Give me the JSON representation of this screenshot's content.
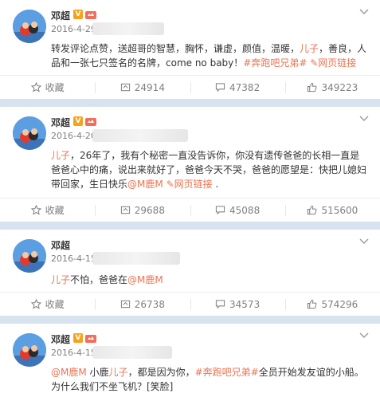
{
  "colors": {
    "accent": "#eb7350",
    "meta": "#808080",
    "separator": "#d7e3ef",
    "badge": "#f7a21a"
  },
  "posts": [
    {
      "user": "邓超",
      "timestamp": "2016-4-29",
      "content": [
        {
          "t": "转发评论点赞，送超哥的智慧，胸怀，谦虚，颜值，温暖，"
        },
        {
          "t": "儿子",
          "h": true
        },
        {
          "t": "，善良，人品和一张七只签名的名牌，come no baby！"
        },
        {
          "t": "#奔跑吧兄弟#",
          "h": true
        },
        {
          "t": " "
        },
        {
          "t": "✎网页链接",
          "h": true
        }
      ],
      "actions": {
        "favorite": "收藏",
        "repost": "24914",
        "comment": "47382",
        "like": "349223"
      }
    },
    {
      "user": "邓超",
      "timestamp": "2016-4-20",
      "content": [
        {
          "t": "儿子",
          "h": true
        },
        {
          "t": "，26年了，我有个秘密一直没告诉你，你没有遗传爸爸的长相一直是爸爸心中的痛，说出来就好了，爸爸今天不哭，爸爸的愿望是：快把儿媳妇带回家，生日快乐"
        },
        {
          "t": "@M鹿M",
          "h": true
        },
        {
          "t": " "
        },
        {
          "t": "✎网页链接",
          "h": true
        },
        {
          "t": " ."
        }
      ],
      "actions": {
        "favorite": "收藏",
        "repost": "29688",
        "comment": "45088",
        "like": "515600"
      }
    },
    {
      "user": "邓超",
      "timestamp": "2016-4-15",
      "content": [
        {
          "t": "儿子",
          "h": true
        },
        {
          "t": "不怕，爸爸在"
        },
        {
          "t": "@M鹿M",
          "h": true
        }
      ],
      "actions": {
        "favorite": "收藏",
        "repost": "26738",
        "comment": "34573",
        "like": "574296"
      }
    },
    {
      "user": "邓超",
      "timestamp": "2016-4-15",
      "content": [
        {
          "t": "@M鹿M",
          "h": true
        },
        {
          "t": " 小鹿"
        },
        {
          "t": "儿子",
          "h": true
        },
        {
          "t": "，都是因为你，"
        },
        {
          "t": "#奔跑吧兄弟#",
          "h": true
        },
        {
          "t": "全员开始发友谊的小船。为什么我们不坐飞机？[笑脸]"
        }
      ]
    }
  ]
}
